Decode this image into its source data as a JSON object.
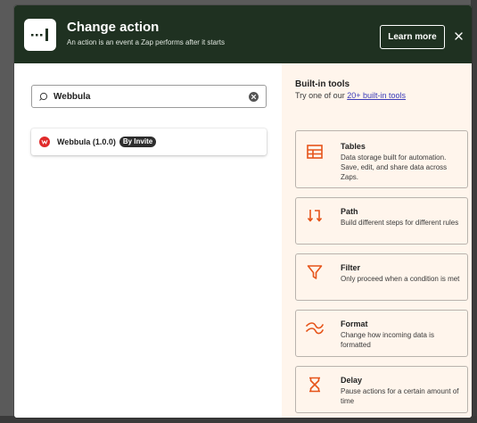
{
  "header": {
    "title": "Change action",
    "subtitle": "An action is an event a Zap performs after it starts",
    "learn_more_label": "Learn more",
    "bg_color": "#1f3121"
  },
  "search": {
    "value": "Webbula"
  },
  "results": [
    {
      "name": "Webbula (1.0.0)",
      "badge": "By Invite",
      "icon": "webbula-logo-icon"
    }
  ],
  "builtin": {
    "title": "Built-in tools",
    "subtitle_prefix": "Try one of our ",
    "subtitle_link": "20+ built-in tools",
    "accent_color": "#e6541a",
    "tools": [
      {
        "name": "Tables",
        "description": "Data storage built for automation. Save, edit, and share data across Zaps.",
        "icon": "table-icon"
      },
      {
        "name": "Path",
        "description": "Build different steps for different rules",
        "icon": "path-icon"
      },
      {
        "name": "Filter",
        "description": "Only proceed when a condition is met",
        "icon": "filter-icon"
      },
      {
        "name": "Format",
        "description": "Change how incoming data is formatted",
        "icon": "format-icon"
      },
      {
        "name": "Delay",
        "description": "Pause actions for a certain amount of time",
        "icon": "hourglass-icon"
      }
    ]
  }
}
